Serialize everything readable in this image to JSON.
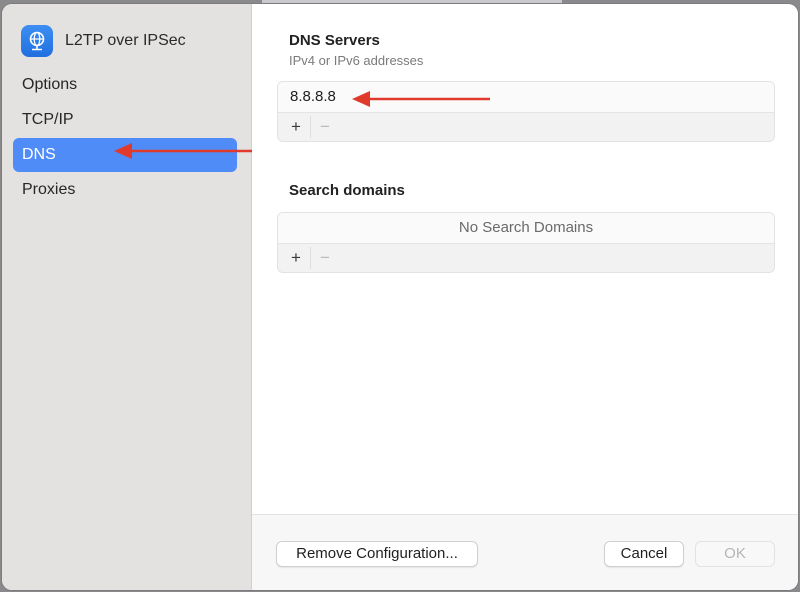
{
  "sidebar": {
    "icon": "globe-network-icon",
    "title": "L2TP over IPSec",
    "items": [
      {
        "label": "Options"
      },
      {
        "label": "TCP/IP"
      },
      {
        "label": "DNS"
      },
      {
        "label": "Proxies"
      }
    ]
  },
  "dns": {
    "title": "DNS Servers",
    "subtitle": "IPv4 or IPv6 addresses",
    "servers": [
      "8.8.8.8"
    ],
    "add_label": "+",
    "remove_label": "−"
  },
  "search": {
    "title": "Search domains",
    "empty_label": "No Search Domains",
    "add_label": "+",
    "remove_label": "−"
  },
  "footer": {
    "remove_config_label": "Remove Configuration...",
    "cancel_label": "Cancel",
    "ok_label": "OK"
  },
  "colors": {
    "accent": "#4f8cf7",
    "annotation_arrow": "#e03a2c"
  }
}
